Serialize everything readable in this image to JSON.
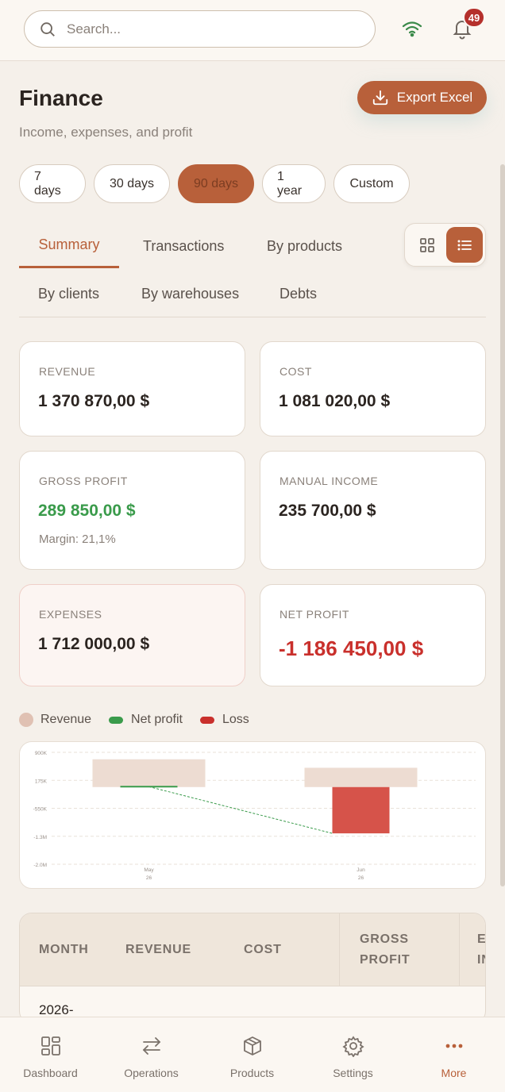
{
  "header": {
    "search_placeholder": "Search...",
    "notification_count": "49"
  },
  "page": {
    "title": "Finance",
    "subtitle": "Income, expenses, and profit",
    "export_label": "Export Excel"
  },
  "ranges": [
    "7 days",
    "30 days",
    "90 days",
    "1 year",
    "Custom"
  ],
  "active_range": "90 days",
  "tabs": [
    "Summary",
    "Transactions",
    "By products",
    "By clients",
    "By warehouses",
    "Debts"
  ],
  "active_tab": "Summary",
  "cards": {
    "revenue": {
      "label": "REVENUE",
      "value": "1 370 870,00 $"
    },
    "cost": {
      "label": "COST",
      "value": "1 081 020,00 $"
    },
    "gross_profit": {
      "label": "GROSS PROFIT",
      "value": "289 850,00 $",
      "note": "Margin: 21,1%"
    },
    "manual_income": {
      "label": "MANUAL INCOME",
      "value": "235 700,00 $"
    },
    "expenses": {
      "label": "EXPENSES",
      "value": "1 712 000,00 $"
    },
    "net_profit": {
      "label": "NET PROFIT",
      "value": "-1 186 450,00 $"
    }
  },
  "legend": {
    "revenue": "Revenue",
    "net_profit": "Net profit",
    "loss": "Loss"
  },
  "chart_data": {
    "type": "bar",
    "categories": [
      "May 26",
      "Jun 26"
    ],
    "y_ticks": [
      "900K",
      "175K",
      "-550K",
      "-1.3M",
      "-2.0M"
    ],
    "ylim": [
      -2000000,
      900000
    ],
    "series": [
      {
        "name": "Revenue",
        "values": [
          720000,
          500000
        ]
      },
      {
        "name": "Net profit",
        "values": [
          10000,
          -1200000
        ]
      },
      {
        "name": "Loss",
        "values": [
          0,
          -1200000
        ]
      }
    ],
    "grid": true,
    "legend_position": "top-left"
  },
  "table": {
    "headers": [
      "MONTH",
      "REVENUE",
      "COST",
      "GROSS PROFIT",
      "E IN"
    ],
    "first_cell": "2026-"
  },
  "nav": [
    {
      "label": "Dashboard",
      "icon": "dashboard-icon"
    },
    {
      "label": "Operations",
      "icon": "arrows-icon"
    },
    {
      "label": "Products",
      "icon": "box-icon"
    },
    {
      "label": "Settings",
      "icon": "gear-icon"
    },
    {
      "label": "More",
      "icon": "more-icon"
    }
  ],
  "colors": {
    "accent": "#b8603a",
    "profit": "#3a9b4b",
    "loss": "#c9302c",
    "revenue_fill": "#eddcd2"
  }
}
